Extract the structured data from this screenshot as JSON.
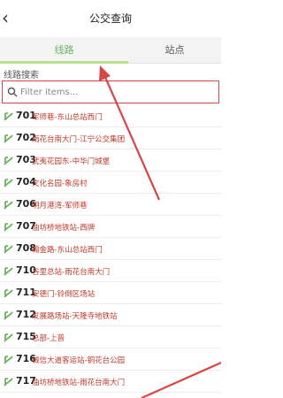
{
  "header": {
    "back_icon": "chevron-left-icon",
    "title": "公交查询"
  },
  "tabs": [
    {
      "label": "线路",
      "active": true
    },
    {
      "label": "站点",
      "active": false
    }
  ],
  "section_label": "线路搜索",
  "search": {
    "placeholder": "Filter items...",
    "value": "",
    "icon": "search-icon"
  },
  "routes": [
    {
      "number": "701",
      "name": "军师巷-东山总站西门"
    },
    {
      "number": "702",
      "name": "雨花台南大门-江宁公交集团"
    },
    {
      "number": "703",
      "name": "武夷花园东-中华门城堡"
    },
    {
      "number": "704",
      "name": "文化名园-象房村"
    },
    {
      "number": "706",
      "name": "明月港湾-军师巷"
    },
    {
      "number": "707",
      "name": "油坊桥地铁站-西牌"
    },
    {
      "number": "708",
      "name": "翰金路-东山总站西门"
    },
    {
      "number": "710",
      "name": "谷里总站-雨花台南大门"
    },
    {
      "number": "711",
      "name": "安德门-铃倒区场站"
    },
    {
      "number": "712",
      "name": "发展路场站-天隆寺地铁站"
    },
    {
      "number": "715",
      "name": "总部-上普"
    },
    {
      "number": "716",
      "name": "诚信大道客运站-铜花台公园"
    },
    {
      "number": "717",
      "name": "油坊桥地铁站-雨花台南大门"
    }
  ],
  "colors": {
    "accent_green": "#6fb56a",
    "highlight_red": "#d64646",
    "route_text": "#c0392b"
  }
}
